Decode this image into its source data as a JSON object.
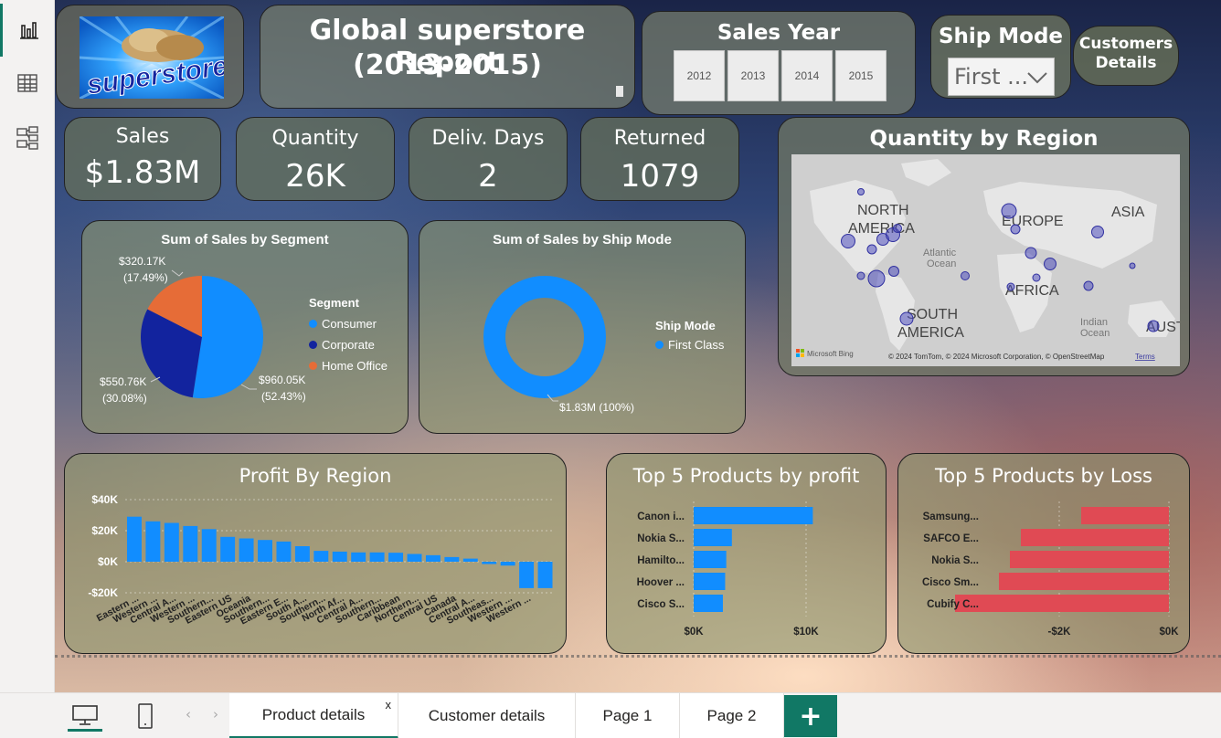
{
  "report": {
    "title_line1": "Global superstore Report",
    "title_line2": "(2013-2015)",
    "logo_text": "superstore"
  },
  "slicer_year": {
    "title": "Sales Year",
    "years": [
      "2012",
      "2013",
      "2014",
      "2015"
    ]
  },
  "slicer_ship": {
    "title": "Ship Mode",
    "selected": "First ..."
  },
  "customers_button": {
    "line1": "Customers",
    "line2": "Details"
  },
  "kpis": [
    {
      "label": "Sales",
      "value": "$1.83M"
    },
    {
      "label": "Quantity",
      "value": "26K"
    },
    {
      "label": "Deliv. Days",
      "value": "2"
    },
    {
      "label": "Returned",
      "value": "1079"
    }
  ],
  "map": {
    "title": "Quantity by Region",
    "labels": [
      "NORTH",
      "AMERICA",
      "EUROPE",
      "ASIA",
      "AFRICA",
      "SOUTH",
      "AMERICA",
      "AUST",
      "Atlantic",
      "Ocean",
      "Indian",
      "Ocean"
    ],
    "bing": "Microsoft Bing",
    "attribution": "© 2024 TomTom, © 2024 Microsoft Corporation, © OpenStreetMap",
    "terms": "Terms"
  },
  "chart_data": [
    {
      "type": "pie",
      "title": "Sum of Sales by Segment",
      "legend_title": "Segment",
      "categories": [
        "Consumer",
        "Corporate",
        "Home Office"
      ],
      "values": [
        960.05,
        550.76,
        320.17
      ],
      "labels": [
        {
          "value": "$960.05K",
          "pct": "(52.43%)"
        },
        {
          "value": "$550.76K",
          "pct": "(30.08%)"
        },
        {
          "value": "$320.17K",
          "pct": "(17.49%)"
        }
      ],
      "colors": [
        "#118dff",
        "#12239e",
        "#e66c37"
      ]
    },
    {
      "type": "pie",
      "title": "Sum of Sales by Ship Mode",
      "legend_title": "Ship Mode",
      "categories": [
        "First Class"
      ],
      "values": [
        1830000
      ],
      "labels": [
        "$1.83M (100%)"
      ],
      "colors": [
        "#118dff"
      ]
    },
    {
      "type": "bar",
      "title": "Profit By Region",
      "categories": [
        "Eastern ...",
        "Western ...",
        "Central A...",
        "Western ...",
        "Southern...",
        "Eastern US",
        "Oceania",
        "Southern...",
        "Eastern E...",
        "South A...",
        "Southern...",
        "North Af...",
        "Central A...",
        "Southern...",
        "Caribbean",
        "Northern...",
        "Central US",
        "Canada",
        "Central A...",
        "Southeas...",
        "Western ...",
        "Western ..."
      ],
      "values": [
        29000,
        26000,
        25000,
        23000,
        21000,
        16000,
        15000,
        14000,
        13000,
        10000,
        7000,
        6500,
        6000,
        6000,
        5800,
        5000,
        4200,
        3000,
        2000,
        -1500,
        -2500,
        -17000,
        -17000
      ],
      "ylim": [
        -20000,
        40000
      ],
      "yticks": [
        "$40K",
        "$20K",
        "$0K",
        "-$20K"
      ],
      "color": "#118dff"
    },
    {
      "type": "bar",
      "title": "Top 5 Products by profit",
      "categories": [
        "Canon i...",
        "Nokia S...",
        "Hamilto...",
        "Hoover ...",
        "Cisco S..."
      ],
      "values": [
        10600,
        3400,
        2900,
        2800,
        2600
      ],
      "xticks": [
        "$0K",
        "$10K"
      ],
      "color": "#118dff"
    },
    {
      "type": "bar",
      "title": "Top 5 Products by Loss",
      "categories": [
        "Samsung...",
        "SAFCO E...",
        "Nokia S...",
        "Cisco Sm...",
        "Cubify C..."
      ],
      "values": [
        -1600,
        -2700,
        -2900,
        -3100,
        -3900
      ],
      "xticks": [
        "-$2K",
        "$0K"
      ],
      "color": "#e04a54"
    }
  ],
  "tabs": {
    "items": [
      "Product details",
      "Customer details",
      "Page 1",
      "Page 2"
    ],
    "active": "Product details",
    "close": "x",
    "add": "+"
  }
}
